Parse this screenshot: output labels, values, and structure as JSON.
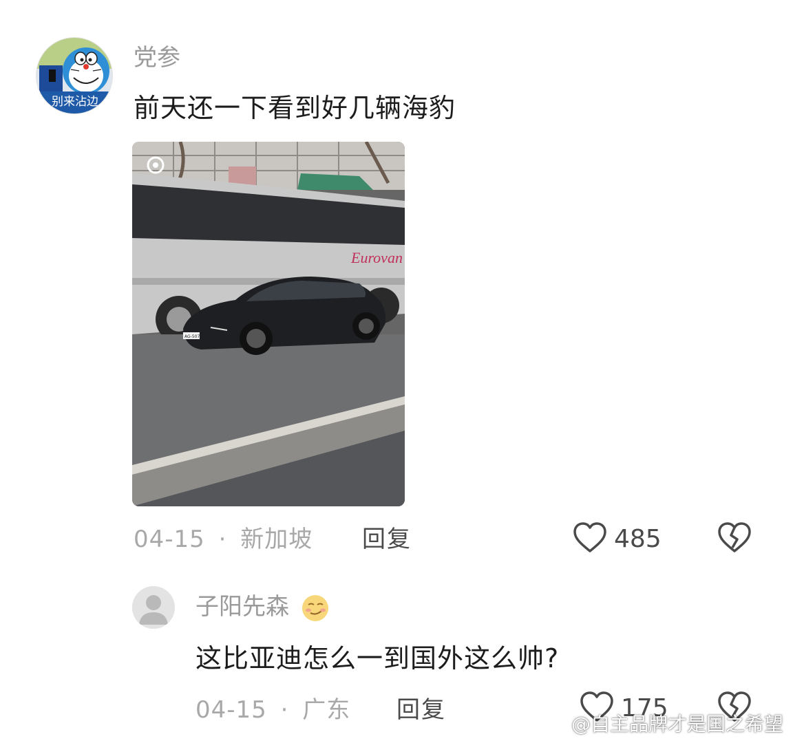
{
  "comment": {
    "username": "党参",
    "avatar_caption": "别来沾边",
    "text": "前天还一下看到好几辆海豹",
    "photo": {
      "plate_text": "AG-507-GK",
      "bus_text": "Eurovan"
    },
    "date": "04-15",
    "location": "新加坡",
    "reply_label": "回复",
    "likes": "485"
  },
  "reply": {
    "username": "子阳先森",
    "text": "这比亚迪怎么一到国外这么帅?",
    "date": "04-15",
    "location": "广东",
    "reply_label": "回复",
    "likes": "175"
  },
  "separator": "·",
  "watermark": "@自主品牌才是国之希望",
  "icons": [
    "heart-icon",
    "broken-heart-icon",
    "default-avatar-icon",
    "smirk-emoji-icon",
    "weibo-logo-icon"
  ],
  "colors": {
    "secondary_text": "#a8a8a8",
    "primary_text": "#1c1c1c",
    "icon": "#4a4a4a"
  }
}
